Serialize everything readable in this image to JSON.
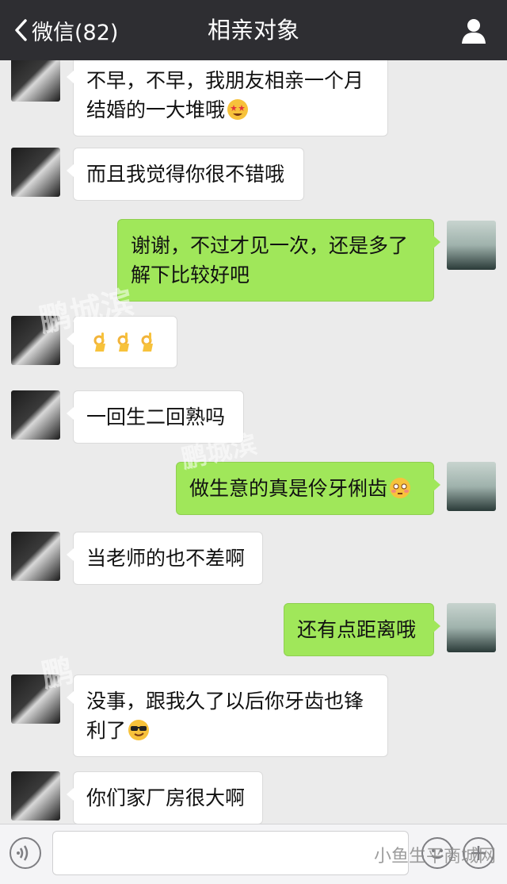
{
  "header": {
    "back_label": "微信(82)",
    "title": "相亲对象"
  },
  "messages": [
    {
      "from": "them",
      "lines": [
        "不早，不早，我朋友相亲一个月",
        "结婚的一大堆哦"
      ],
      "emoji": "star-struck-emoji"
    },
    {
      "from": "them",
      "lines": [
        "而且我觉得你很不错哦"
      ]
    },
    {
      "from": "me",
      "lines": [
        "谢谢，不过才见一次，还是多了",
        "解下比较好吧"
      ]
    },
    {
      "from": "them",
      "lines": [
        ""
      ],
      "emoji": "ok-hand-emoji-x3"
    },
    {
      "from": "them",
      "lines": [
        "一回生二回熟吗"
      ]
    },
    {
      "from": "me",
      "lines": [
        "做生意的真是伶牙俐齿"
      ],
      "emoji": "flushed-emoji"
    },
    {
      "from": "them",
      "lines": [
        "当老师的也不差啊"
      ]
    },
    {
      "from": "me",
      "lines": [
        "还有点距离哦"
      ]
    },
    {
      "from": "them",
      "lines": [
        "没事，跟我久了以后你牙齿也锋",
        "利了"
      ],
      "emoji": "sunglasses-emoji"
    },
    {
      "from": "them",
      "lines": [
        "你们家厂房很大啊"
      ]
    }
  ],
  "watermarks": [
    "鹏城滨",
    "鹏城滨",
    "鹏",
    "小鱼生平商城网"
  ],
  "colors": {
    "nav_bg": "#2e2e32",
    "chat_bg": "#ebebeb",
    "out_bubble": "#a0e75a",
    "in_bubble": "#ffffff"
  }
}
